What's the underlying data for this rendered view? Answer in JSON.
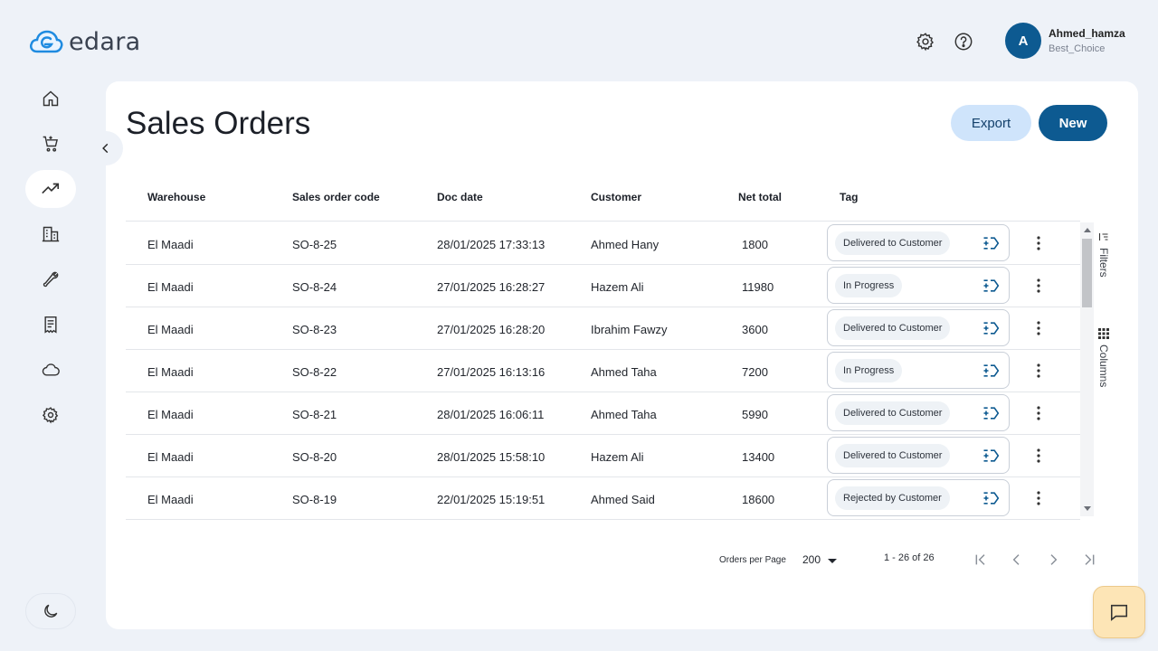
{
  "app": {
    "logo_text": "edara",
    "brand_color": "#0d5a91",
    "accent_light": "#cfe4fb"
  },
  "header": {
    "icons": [
      "gear-icon",
      "help-icon"
    ],
    "user": {
      "initial": "A",
      "name": "Ahmed_hamza",
      "org": "Best_Choice"
    }
  },
  "sidebar": {
    "items": [
      {
        "name": "home",
        "icon": "home-icon"
      },
      {
        "name": "sales",
        "icon": "cart-icon"
      },
      {
        "name": "analytics",
        "icon": "trending-up-icon",
        "active": true
      },
      {
        "name": "warehouse",
        "icon": "building-icon"
      },
      {
        "name": "tools",
        "icon": "wrench-icon"
      },
      {
        "name": "documents",
        "icon": "receipt-icon"
      },
      {
        "name": "cloud",
        "icon": "cloud-icon"
      },
      {
        "name": "settings",
        "icon": "gear-icon"
      }
    ],
    "theme_icon": "moon-icon"
  },
  "page": {
    "title": "Sales Orders",
    "export_label": "Export",
    "new_label": "New"
  },
  "table": {
    "columns": [
      "Warehouse",
      "Sales order code",
      "Doc date",
      "Customer",
      "Net total",
      "Tag"
    ],
    "rows": [
      {
        "warehouse": "El Maadi",
        "code": "SO-8-25",
        "date": "28/01/2025 17:33:13",
        "customer": "Ahmed Hany",
        "total": "1800",
        "tag": "Delivered to Customer"
      },
      {
        "warehouse": "El Maadi",
        "code": "SO-8-24",
        "date": "27/01/2025 16:28:27",
        "customer": "Hazem Ali",
        "total": "11980",
        "tag": "In Progress"
      },
      {
        "warehouse": "El Maadi",
        "code": "SO-8-23",
        "date": "27/01/2025 16:28:20",
        "customer": "Ibrahim Fawzy",
        "total": "3600",
        "tag": "Delivered to Customer"
      },
      {
        "warehouse": "El Maadi",
        "code": "SO-8-22",
        "date": "27/01/2025 16:13:16",
        "customer": "Ahmed Taha",
        "total": "7200",
        "tag": "In Progress"
      },
      {
        "warehouse": "El Maadi",
        "code": "SO-8-21",
        "date": "28/01/2025 16:06:11",
        "customer": "Ahmed Taha",
        "total": "5990",
        "tag": "Delivered to Customer"
      },
      {
        "warehouse": "El Maadi",
        "code": "SO-8-20",
        "date": "28/01/2025 15:58:10",
        "customer": "Hazem Ali",
        "total": "13400",
        "tag": "Delivered to Customer"
      },
      {
        "warehouse": "El Maadi",
        "code": "SO-8-19",
        "date": "22/01/2025 15:19:51",
        "customer": "Ahmed Said",
        "total": "18600",
        "tag": "Rejected by Customer"
      }
    ]
  },
  "tools": {
    "filters_label": "Filters",
    "columns_label": "Columns"
  },
  "pagination": {
    "per_page_label": "Orders per Page",
    "per_page_value": "200",
    "range": "1 - 26 of 26"
  }
}
